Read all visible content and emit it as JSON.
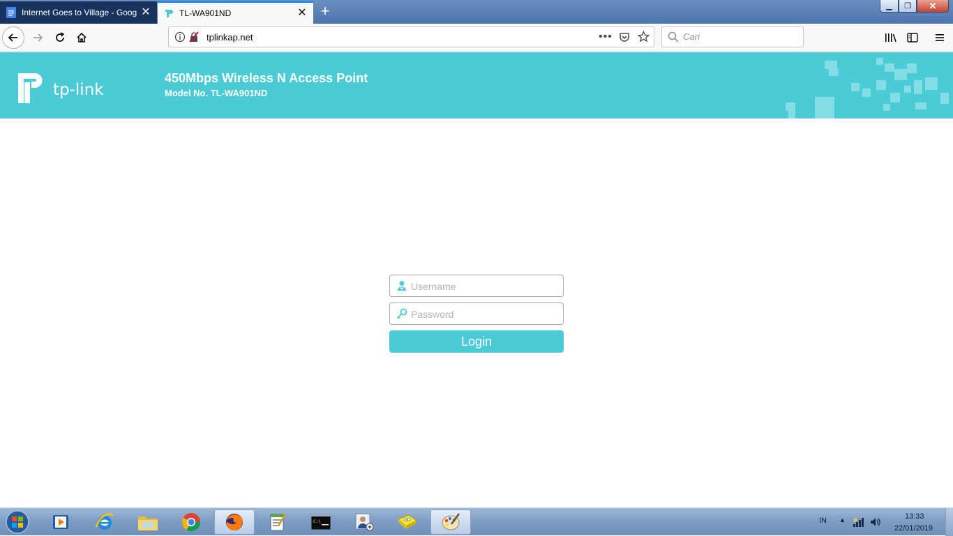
{
  "browser": {
    "tabs": [
      {
        "title": "Internet Goes to Village - Googl",
        "active": false,
        "icon": "google-docs-icon"
      },
      {
        "title": "TL-WA901ND",
        "active": true,
        "icon": "tp-link-favicon"
      }
    ],
    "url": "tplinkap.net",
    "search_placeholder": "Cari"
  },
  "header": {
    "brand": "tp-link",
    "product": "450Mbps Wireless N Access Point",
    "model": "Model No. TL-WA901ND"
  },
  "login": {
    "username_placeholder": "Username",
    "password_placeholder": "Password",
    "login_label": "Login"
  },
  "taskbar": {
    "apps": [
      "media-player-icon",
      "internet-explorer-icon",
      "file-explorer-icon",
      "chrome-icon",
      "firefox-icon",
      "notepad-icon",
      "command-prompt-icon",
      "user-accounts-icon",
      "spongebob-icon",
      "paint-icon"
    ],
    "active_app": "firefox-icon",
    "language": "IN",
    "time": "13:33",
    "date": "22/01/2019"
  },
  "colors": {
    "brand_teal": "#4acbd6",
    "tab_dark": "#17335e",
    "accent_blue": "#0a84ff"
  }
}
